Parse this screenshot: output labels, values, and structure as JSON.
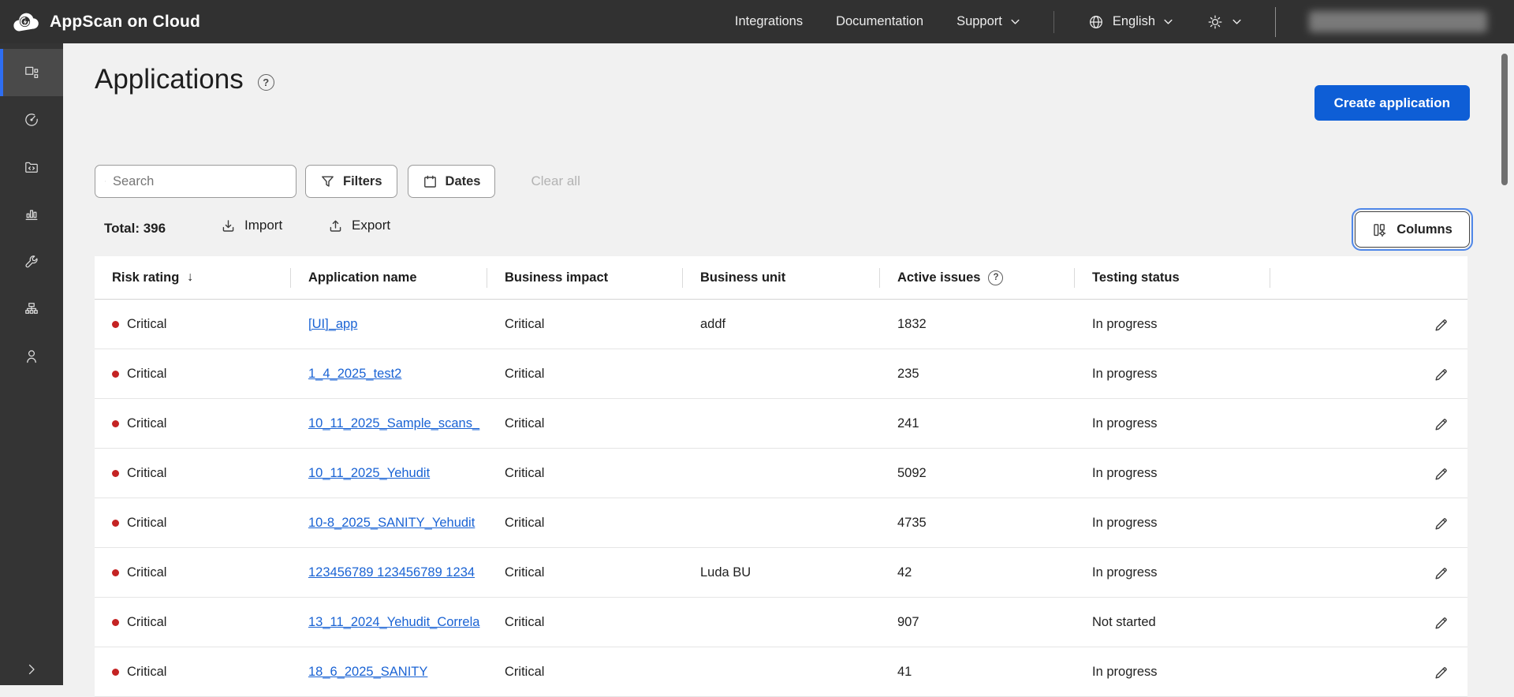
{
  "header": {
    "brand": "AppScan on Cloud",
    "nav": [
      {
        "label": "Integrations",
        "chevron": false
      },
      {
        "label": "Documentation",
        "chevron": false
      },
      {
        "label": "Support",
        "chevron": true
      }
    ],
    "language": "English",
    "icons": [
      "cloud-logo-icon",
      "globe-icon",
      "theme-sun-icon",
      "chevron-down-icon"
    ],
    "user_account": "redacted"
  },
  "sidebar": {
    "items": [
      {
        "icon": "applications-grid-icon",
        "active": true
      },
      {
        "icon": "scan-gauge-icon",
        "active": false
      },
      {
        "icon": "code-folder-icon",
        "active": false
      },
      {
        "icon": "bar-chart-icon",
        "active": false
      },
      {
        "icon": "wrench-icon",
        "active": false
      },
      {
        "icon": "network-hierarchy-icon",
        "active": false
      },
      {
        "icon": "user-icon",
        "active": false
      }
    ],
    "expand_icon": "chevron-right-icon"
  },
  "page": {
    "title": "Applications",
    "help_glyph": "?",
    "create_button_label": "Create application"
  },
  "toolbar": {
    "search_placeholder": "Search",
    "filters_label": "Filters",
    "dates_label": "Dates",
    "clear_all_label": "Clear all"
  },
  "listbar": {
    "total_label": "Total: 396",
    "import_label": "Import",
    "export_label": "Export",
    "columns_label": "Columns"
  },
  "table": {
    "headers": {
      "risk": "Risk rating",
      "name": "Application name",
      "impact": "Business impact",
      "unit": "Business unit",
      "issues": "Active issues",
      "status": "Testing status"
    },
    "sort": {
      "column": "risk",
      "direction": "desc",
      "glyph": "↓"
    },
    "rows": [
      {
        "risk": "Critical",
        "name": "[UI]_app",
        "impact": "Critical",
        "unit": "addf",
        "issues": "1832",
        "status": "In progress"
      },
      {
        "risk": "Critical",
        "name": "1_4_2025_test2",
        "impact": "Critical",
        "unit": "",
        "issues": "235",
        "status": "In progress"
      },
      {
        "risk": "Critical",
        "name": "10_11_2025_Sample_scans_",
        "impact": "Critical",
        "unit": "",
        "issues": "241",
        "status": "In progress"
      },
      {
        "risk": "Critical",
        "name": "10_11_2025_Yehudit",
        "impact": "Critical",
        "unit": "",
        "issues": "5092",
        "status": "In progress"
      },
      {
        "risk": "Critical",
        "name": "10-8_2025_SANITY_Yehudit",
        "impact": "Critical",
        "unit": "",
        "issues": "4735",
        "status": "In progress"
      },
      {
        "risk": "Critical",
        "name": "123456789 123456789 1234",
        "impact": "Critical",
        "unit": "Luda BU",
        "issues": "42",
        "status": "In progress"
      },
      {
        "risk": "Critical",
        "name": "13_11_2024_Yehudit_Correla",
        "impact": "Critical",
        "unit": "",
        "issues": "907",
        "status": "Not started"
      },
      {
        "risk": "Critical",
        "name": "18_6_2025_SANITY",
        "impact": "Critical",
        "unit": "",
        "issues": "41",
        "status": "In progress"
      }
    ]
  },
  "colors": {
    "header_bg": "#313131",
    "accent_blue": "#0e5ed6",
    "link_blue": "#1a63d4",
    "risk_red": "#c42323",
    "page_bg": "#f1f1f1"
  }
}
